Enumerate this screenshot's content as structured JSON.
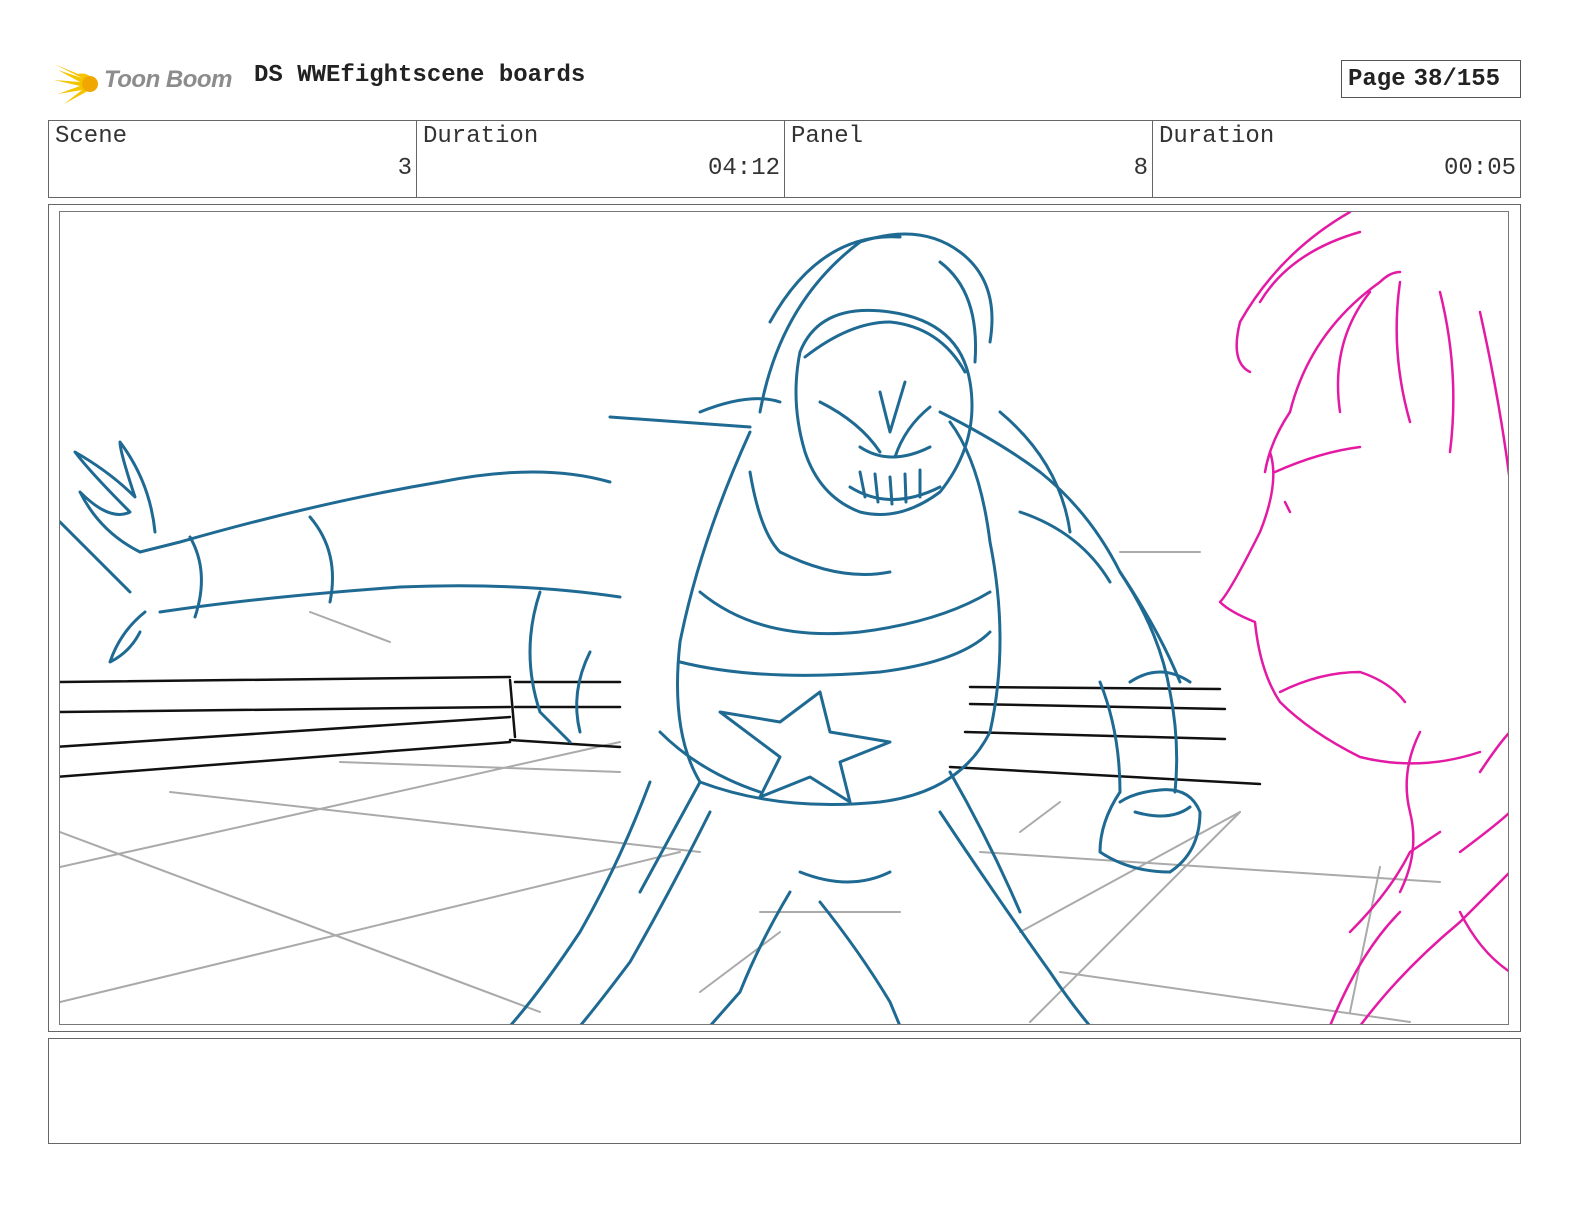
{
  "header": {
    "logo_text": "Toon Boom",
    "title": "DS WWEfightscene boards",
    "page_label": "Page",
    "page_value": "38/155"
  },
  "info": {
    "scene_label": "Scene",
    "scene_value": "3",
    "scene_duration_label": "Duration",
    "scene_duration_value": "04:12",
    "panel_label": "Panel",
    "panel_value": "8",
    "panel_duration_label": "Duration",
    "panel_duration_value": "00:05"
  },
  "colors": {
    "wrestler_stroke": "#1f6a93",
    "foreground_stroke": "#e31aa4",
    "ring_ropes": "#111111",
    "floor_lines": "#aaaaaa",
    "logo_flame": "#f5c400"
  },
  "icons": [
    "toon-boom-logo-icon"
  ],
  "notes": {
    "text": ""
  }
}
